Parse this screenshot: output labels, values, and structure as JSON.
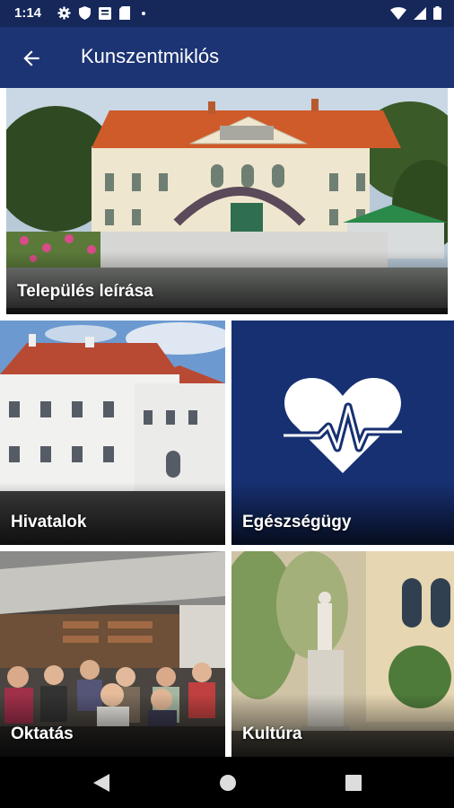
{
  "status_bar": {
    "time": "1:14",
    "icons": [
      "settings-icon",
      "shield-icon",
      "news-icon",
      "sd-card-icon",
      "dot-icon"
    ],
    "right_icons": [
      "wifi-icon",
      "signal-icon",
      "battery-icon"
    ]
  },
  "app_bar": {
    "back_icon": "arrow-left-icon",
    "title": "Kunszentmiklós"
  },
  "tiles": [
    {
      "label": "Település leírása"
    },
    {
      "label": "Hivatalok"
    },
    {
      "label": "Egészségügy",
      "icon": "heart-pulse-icon"
    },
    {
      "label": "Oktatás"
    },
    {
      "label": "Kultúra"
    }
  ],
  "colors": {
    "app_bar": "#1c3474",
    "status_bar": "#16285a",
    "health_tile": "#173072"
  },
  "nav_bar": {
    "icons": [
      "back-triangle-icon",
      "home-circle-icon",
      "recents-square-icon"
    ]
  }
}
